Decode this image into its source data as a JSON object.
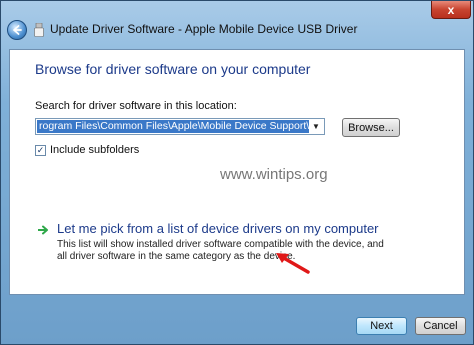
{
  "window": {
    "title": "Update Driver Software - Apple Mobile Device USB Driver",
    "close_label": "x"
  },
  "page": {
    "heading": "Browse for driver software on your computer",
    "location_label": "Search for driver software in this location:",
    "path_value": "rogram Files\\Common Files\\Apple\\Mobile Device Support\\Drivers",
    "browse_label": "Browse...",
    "include_subfolders_label": "Include subfolders",
    "include_subfolders_checked": true,
    "watermark": "www.wintips.org",
    "pick_option": {
      "title": "Let me pick from a list of device drivers on my computer",
      "description": "This list will show installed driver software compatible with the device, and all driver software in the same category as the device."
    }
  },
  "footer": {
    "next_label": "Next",
    "cancel_label": "Cancel"
  },
  "colors": {
    "heading": "#1c3a8a",
    "selection": "#3a78c8",
    "option_arrow": "#2fa84a",
    "annotation_arrow": "#e01818"
  },
  "icons": [
    "back-arrow-icon",
    "usb-device-icon",
    "close-icon",
    "dropdown-arrow-icon",
    "green-arrow-icon",
    "red-pointer-arrow-icon"
  ]
}
